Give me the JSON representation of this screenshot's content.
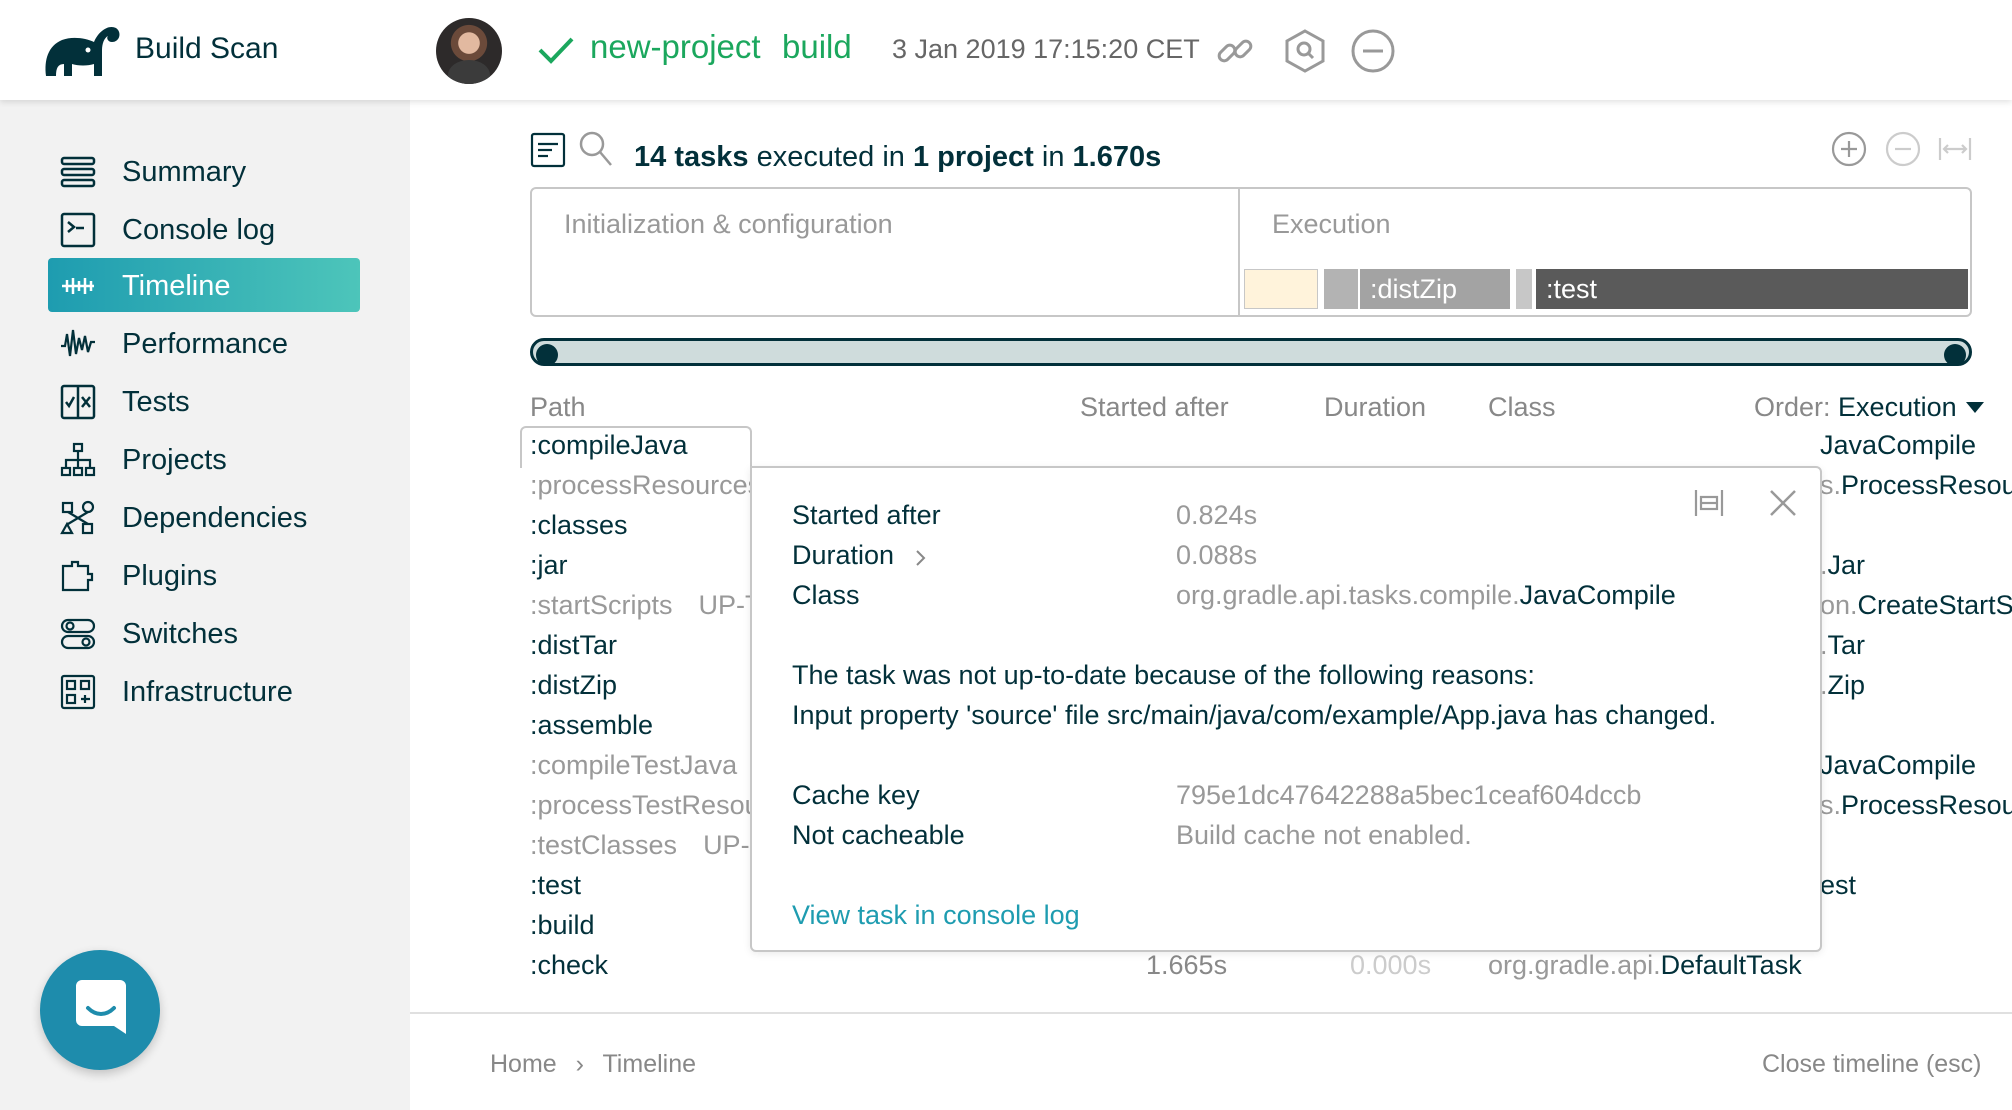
{
  "header": {
    "brand": "Build Scan",
    "project": "new-project",
    "task": "build",
    "timestamp": "3 Jan 2019 17:15:20 CET"
  },
  "sidebar": {
    "items": [
      {
        "label": "Summary",
        "icon": "summary-icon"
      },
      {
        "label": "Console log",
        "icon": "console-icon"
      },
      {
        "label": "Timeline",
        "icon": "timeline-icon",
        "active": true
      },
      {
        "label": "Performance",
        "icon": "performance-icon"
      },
      {
        "label": "Tests",
        "icon": "tests-icon"
      },
      {
        "label": "Projects",
        "icon": "projects-icon"
      },
      {
        "label": "Dependencies",
        "icon": "dependencies-icon"
      },
      {
        "label": "Plugins",
        "icon": "plugins-icon"
      },
      {
        "label": "Switches",
        "icon": "switches-icon"
      },
      {
        "label": "Infrastructure",
        "icon": "infrastructure-icon"
      }
    ]
  },
  "summary": {
    "count": "14",
    "word_tasks": "tasks",
    "word_executed": "executed in",
    "projects": "1 project",
    "word_in": "in",
    "duration": "1.670s"
  },
  "phases": {
    "init": "Initialization & configuration",
    "exec": "Execution",
    "bars": [
      ":distZip",
      ":test"
    ]
  },
  "table": {
    "headers": {
      "path": "Path",
      "started": "Started after",
      "duration": "Duration",
      "class": "Class",
      "order_label": "Order:",
      "order_value": "Execution"
    },
    "rows": [
      {
        "path": ":compileJava",
        "dim": false,
        "cls_pre": "",
        "cls": "JavaCompile"
      },
      {
        "path": ":processResources",
        "dim": true,
        "cls_pre": "s.",
        "cls": "ProcessResour"
      },
      {
        "path": ":classes",
        "dim": false,
        "cls_pre": "",
        "cls": ""
      },
      {
        "path": ":jar",
        "dim": false,
        "cls_pre": ".",
        "cls": "Jar"
      },
      {
        "path": ":startScripts",
        "dim": true,
        "utd": "UP-T",
        "cls_pre": "on.",
        "cls": "CreateStartSc"
      },
      {
        "path": ":distTar",
        "dim": false,
        "cls_pre": ".",
        "cls": "Tar"
      },
      {
        "path": ":distZip",
        "dim": false,
        "cls_pre": ".",
        "cls": "Zip"
      },
      {
        "path": ":assemble",
        "dim": false,
        "cls_pre": "",
        "cls": ""
      },
      {
        "path": ":compileTestJava",
        "dim": true,
        "cls_pre": "",
        "cls": "JavaCompile"
      },
      {
        "path": ":processTestResour",
        "dim": true,
        "cls_pre": "s.",
        "cls": "ProcessResour"
      },
      {
        "path": ":testClasses",
        "dim": true,
        "utd": "UP-T",
        "cls_pre": "",
        "cls": ""
      },
      {
        "path": ":test",
        "dim": false,
        "cls_pre": "",
        "cls": "est"
      },
      {
        "path": ":build",
        "dim": false,
        "cls_pre": "",
        "cls": ""
      },
      {
        "path": ":check",
        "dim": false,
        "cls_pre": "",
        "cls": ""
      }
    ],
    "check_row": {
      "started": "1.665s",
      "duration": "0.000s",
      "cls_pre": "org.gradle.api.",
      "cls": "DefaultTask"
    }
  },
  "popup": {
    "started_label": "Started after",
    "started_value": "0.824s",
    "duration_label": "Duration",
    "duration_value": "0.088s",
    "class_label": "Class",
    "class_pre": "org.gradle.api.tasks.compile.",
    "class_value": "JavaCompile",
    "reason_title": "The task was not up-to-date because of the following reasons:",
    "reason_detail": "Input property 'source' file src/main/java/com/example/App.java has changed.",
    "cache_key_label": "Cache key",
    "cache_key_value": "795e1dc47642288a5bec1ceaf604dccb",
    "not_cacheable_label": "Not cacheable",
    "not_cacheable_value": "Build cache not enabled.",
    "link": "View task in console log"
  },
  "footer": {
    "home": "Home",
    "sep": "›",
    "current": "Timeline",
    "close": "Close timeline (esc)"
  },
  "colors": {
    "accent": "#1e9cb0",
    "success": "#1ba75d",
    "dark": "#02303a"
  }
}
